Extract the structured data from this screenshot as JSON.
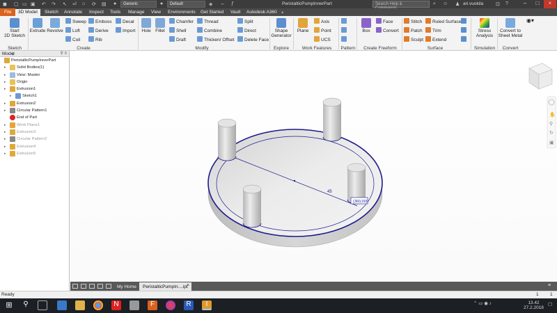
{
  "titlebar": {
    "material": "Generic",
    "appearance": "Default",
    "doc_title": "PeristalticPumpInnerPart",
    "search_placeholder": "Search Help & Commands...",
    "user": "ari.vuokila"
  },
  "tabs": [
    "File",
    "3D Model",
    "Sketch",
    "Annotate",
    "Inspect",
    "Tools",
    "Manage",
    "View",
    "Environments",
    "Get Started",
    "Vault",
    "Autodesk A360"
  ],
  "ribbon": {
    "start_sketch": [
      "Start",
      "2D Sketch"
    ],
    "extrude": "Extrude",
    "revolve": "Revolve",
    "sweep": "Sweep",
    "loft": "Loft",
    "coil": "Coil",
    "emboss": "Emboss",
    "derive": "Derive",
    "rib": "Rib",
    "decal": "Decal",
    "import": "Import",
    "hole": "Hole",
    "fillet": "Fillet",
    "chamfer": "Chamfer",
    "shell": "Shell",
    "draft": "Draft",
    "thread": "Thread",
    "combine": "Combine",
    "thicken": "Thicken/ Offset",
    "split": "Split",
    "direct": "Direct",
    "delete_face": "Delete Face",
    "shape_generator": [
      "Shape",
      "Generator"
    ],
    "plane": "Plane",
    "axis": "Axis",
    "point": "Point",
    "ucs": "UCS",
    "box": "Box",
    "face": "Face",
    "convert": "Convert",
    "stitch": "Stitch",
    "patch": "Patch",
    "sculpt": "Sculpt",
    "ruled_surface": "Ruled Surface",
    "trim": "Trim",
    "extend": "Extend",
    "stress_analysis": [
      "Stress",
      "Analysis"
    ],
    "convert_sheet_metal": [
      "Convert to",
      "Sheet Metal"
    ],
    "groups": [
      "Sketch",
      "Create",
      "Modify",
      "Explore",
      "Work Features",
      "Pattern",
      "Create Freeform",
      "Surface",
      "Simulation",
      "Convert"
    ]
  },
  "browser": {
    "title": "Model",
    "items": [
      {
        "label": "PeristalticPumpInnerPart",
        "icon": "part-icon",
        "dim": false,
        "indent": 0
      },
      {
        "label": "Solid Bodies(1)",
        "icon": "folder-icon",
        "dim": false,
        "indent": 1
      },
      {
        "label": "View: Master",
        "icon": "view-icon",
        "dim": false,
        "indent": 1
      },
      {
        "label": "Origin",
        "icon": "folder-icon",
        "dim": false,
        "indent": 1
      },
      {
        "label": "Extrusion1",
        "icon": "extrusion-icon",
        "dim": false,
        "indent": 1
      },
      {
        "label": "Sketch1",
        "icon": "sketch-icon",
        "dim": false,
        "indent": 2
      },
      {
        "label": "Extrusion2",
        "icon": "extrusion-icon",
        "dim": false,
        "indent": 1
      },
      {
        "label": "Circular Pattern1",
        "icon": "pattern-icon",
        "dim": false,
        "indent": 1
      },
      {
        "label": "End of Part",
        "icon": "end-of-part-icon",
        "dim": false,
        "indent": 1
      },
      {
        "label": "Work Plane1",
        "icon": "workplane-icon",
        "dim": true,
        "indent": 1
      },
      {
        "label": "Extrusion3",
        "icon": "extrusion-icon",
        "dim": true,
        "indent": 1
      },
      {
        "label": "Circular Pattern2",
        "icon": "pattern-icon",
        "dim": true,
        "indent": 1
      },
      {
        "label": "Extrusion4",
        "icon": "extrusion-icon",
        "dim": true,
        "indent": 1
      },
      {
        "label": "Extrusion5",
        "icon": "extrusion-icon",
        "dim": true,
        "indent": 1
      }
    ]
  },
  "viewport": {
    "dimension_label": "45",
    "angle_label": "(360,00)"
  },
  "viewtabs": {
    "home": "My Home",
    "doc": "PeristalticPumpIn....ipt"
  },
  "status": {
    "text": "Ready",
    "count_a": "1",
    "count_b": "1"
  },
  "taskbar": {
    "time": "13.42",
    "date": "27.2.2018"
  },
  "colors": {
    "accent": "#d9631e",
    "sketch_line": "#1a1a8c",
    "part_gray": "#dcdcdc"
  }
}
